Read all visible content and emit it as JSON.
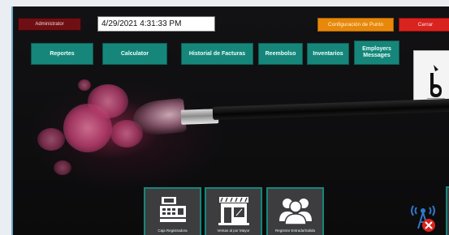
{
  "header": {
    "user": "Administrator",
    "datetime": "4/29/2021 4:31:33 PM",
    "config_label": "Configuración de Punto",
    "close_label": "Cerrar"
  },
  "nav": {
    "items": [
      {
        "label": "Reportes"
      },
      {
        "label": "Calculator"
      },
      {
        "label": "Historial de Facturas"
      },
      {
        "label": "Reembolso"
      },
      {
        "label": "Inventarios"
      },
      {
        "label": "Employers Messages"
      }
    ]
  },
  "tiles": [
    {
      "label": "Caja Registradora",
      "icon": "cash-register-icon"
    },
    {
      "label": "Ventas al por Mayor",
      "icon": "storefront-icon"
    },
    {
      "label": "Registrar Entrada/Salida",
      "icon": "people-icon"
    }
  ],
  "status": {
    "icon": "signal-tower-disconnected-icon"
  },
  "colors": {
    "teal": "#16867a",
    "admin_red": "#6e0f14",
    "orange": "#e8880b",
    "red": "#d8231f"
  }
}
